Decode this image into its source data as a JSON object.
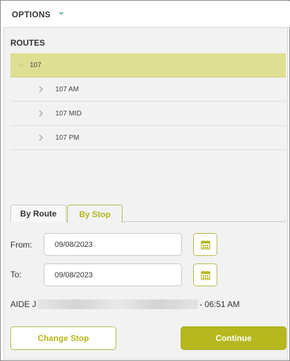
{
  "options": {
    "title": "OPTIONS",
    "icon": "chevron-down-icon"
  },
  "routes": {
    "label": "ROUTES",
    "items": [
      {
        "label": "107",
        "selected": true,
        "expanded": true
      },
      {
        "label": "107 AM",
        "selected": false
      },
      {
        "label": "107 MID",
        "selected": false
      },
      {
        "label": "107 PM",
        "selected": false
      }
    ]
  },
  "tabs": {
    "by_route": "By Route",
    "by_stop": "By Stop",
    "active": "By Stop"
  },
  "form": {
    "from_label": "From:",
    "from_value": "09/08/2023",
    "to_label": "To:",
    "to_value": "09/08/2023"
  },
  "aide": {
    "prefix": "AIDE J",
    "suffix": "- 06:51 AM"
  },
  "buttons": {
    "change_stop": "Change Stop",
    "continue": "Continue"
  },
  "colors": {
    "accent": "#b7b81e",
    "selected_row": "#dfdf94",
    "panel_bg": "#f2f2f2"
  }
}
